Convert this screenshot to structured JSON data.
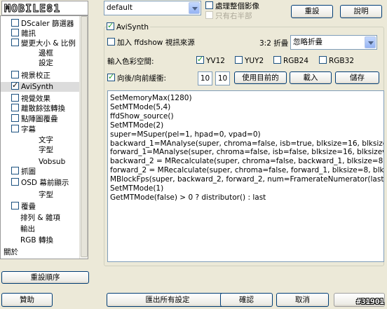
{
  "logo": "MOBILE81",
  "tree_items": [
    {
      "label": "DScaler 篩選器",
      "checkbox": true,
      "checked": false,
      "indent": 0
    },
    {
      "label": "雜訊",
      "checkbox": true,
      "checked": false,
      "indent": 0
    },
    {
      "label": "變更大小 & 比例",
      "checkbox": true,
      "checked": false,
      "indent": 0
    },
    {
      "label": "邊框",
      "checkbox": false,
      "checked": false,
      "indent": 2
    },
    {
      "label": "設定",
      "checkbox": false,
      "checked": false,
      "indent": 2
    },
    {
      "label": "視景校正",
      "checkbox": true,
      "checked": false,
      "indent": 0
    },
    {
      "label": "AviSynth",
      "checkbox": true,
      "checked": true,
      "indent": 0,
      "selected": true
    },
    {
      "label": "視覺效果",
      "checkbox": true,
      "checked": false,
      "indent": 0
    },
    {
      "label": "離散餘弦轉換",
      "checkbox": true,
      "checked": false,
      "indent": 0
    },
    {
      "label": "點陣圖覆疊",
      "checkbox": true,
      "checked": false,
      "indent": 0
    },
    {
      "label": "字幕",
      "checkbox": true,
      "checked": false,
      "indent": 0
    },
    {
      "label": "文字",
      "checkbox": false,
      "checked": false,
      "indent": 2
    },
    {
      "label": "字型",
      "checkbox": false,
      "checked": false,
      "indent": 2
    },
    {
      "label": "Vobsub",
      "checkbox": false,
      "checked": false,
      "indent": 2
    },
    {
      "label": "抓圖",
      "checkbox": true,
      "checked": false,
      "indent": 0
    },
    {
      "label": "OSD 幕前顯示",
      "checkbox": true,
      "checked": false,
      "indent": 0
    },
    {
      "label": "字型",
      "checkbox": false,
      "checked": false,
      "indent": 2
    },
    {
      "label": "覆疊",
      "checkbox": true,
      "checked": false,
      "indent": 0
    },
    {
      "label": "排列 & 雜項",
      "checkbox": false,
      "checked": false,
      "indent": 1
    },
    {
      "label": "輸出",
      "checkbox": false,
      "checked": false,
      "indent": 1
    },
    {
      "label": "RGB 轉換",
      "checkbox": false,
      "checked": false,
      "indent": 1
    },
    {
      "label": "關於",
      "checkbox": false,
      "checked": false,
      "indent": -1
    }
  ],
  "buttons": {
    "reset_order": "重設順序",
    "reset": "重設",
    "help": "說明",
    "use_current": "使用目前的",
    "load": "載入",
    "save": "儲存",
    "donate": "贊助",
    "export_all": "匯出所有設定",
    "ok": "確認",
    "cancel": "取消"
  },
  "top": {
    "preset": "default",
    "process_whole": "處理整個影像",
    "only_right_half": "只有右半部"
  },
  "avisynth": {
    "title": "AviSynth",
    "add_source": "加入 ffdshow 視訊來源",
    "pulldown_label": "3:2 折疊",
    "pulldown_value": "忽略折疊",
    "input_colorspace": "輸入色彩空間:",
    "colorspaces": [
      {
        "label": "YV12",
        "checked": true
      },
      {
        "label": "YUY2",
        "checked": false
      },
      {
        "label": "RGB24",
        "checked": false
      },
      {
        "label": "RGB32",
        "checked": false
      }
    ],
    "buffer_label": "向後/向前緩衝:",
    "buffer_back": "10",
    "buffer_forward": "10",
    "script": [
      "SetMemoryMax(1280)",
      "SetMTMode(5,4)",
      "ffdShow_source()",
      "SetMTMode(2)",
      "super=MSuper(pel=1, hpad=0, vpad=0)",
      "backward_1=MAnalyse(super, chroma=false, isb=true, blksize=16, blksize",
      "forward_1=MAnalyse(super, chroma=false, isb=false, blksize=16, blksizev",
      "backward_2 = MRecalculate(super, chroma=false, backward_1, blksize=8,",
      "forward_2 = MRecalculate(super, chroma=false, forward_1, blksize=8, blk",
      "MBlockFps(super, backward_2, forward_2, num=FramerateNumerator(last)",
      "SetMTMode(1)",
      "GetMTMode(false) > 0 ? distributor() : last"
    ]
  },
  "watermark": "#31901"
}
